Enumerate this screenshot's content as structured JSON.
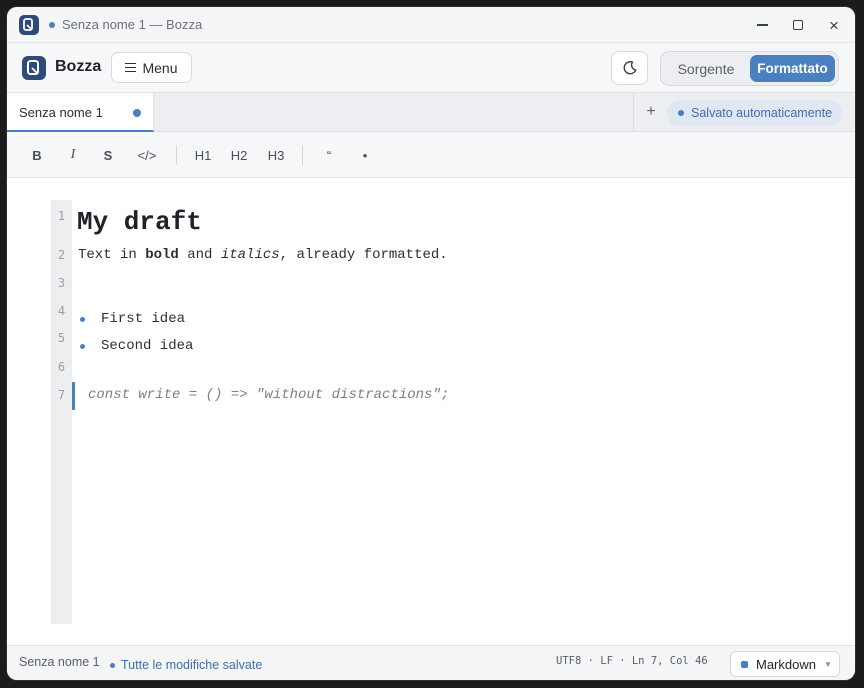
{
  "window": {
    "title": "Senza nome 1 — Bozza",
    "controls": {
      "minimize": "minimize-icon",
      "maximize": "maximize-icon",
      "close": "×"
    }
  },
  "header": {
    "app_name": "Bozza",
    "menu_label": "Menu",
    "theme_icon": "moon-icon",
    "view_modes": {
      "source": "Sorgente",
      "formatted": "Formattato",
      "active": "Formattato"
    }
  },
  "tabs": {
    "items": [
      {
        "label": "Senza nome 1",
        "unsaved": true
      }
    ],
    "add_label": "+",
    "autosave_badge": "Salvato automaticamente"
  },
  "toolbar": {
    "bold": "B",
    "italic": "I",
    "strike": "S",
    "code": "</>",
    "h1": "H1",
    "h2": "H2",
    "h3": "H3",
    "quote": "“",
    "list": "•"
  },
  "editor": {
    "line_numbers": [
      "1",
      "2",
      "3",
      "4",
      "5",
      "6",
      "7"
    ],
    "heading": "My draft",
    "para": {
      "t1": "Text in ",
      "bold": "bold",
      "t2": " and ",
      "italic": "italics",
      "t3": ", already formatted."
    },
    "list_items": [
      "First idea",
      "Second idea"
    ],
    "code_line": "const write = () => \"without distractions\";"
  },
  "statusbar": {
    "file_name": "Senza nome 1",
    "saved_text": "Tutte le modifiche salvate",
    "meta": "UTF8 · LF · Ln 7, Col 46",
    "language": "Markdown"
  },
  "colors": {
    "accent": "#4a7fc1",
    "logo": "#2e4a7a"
  }
}
